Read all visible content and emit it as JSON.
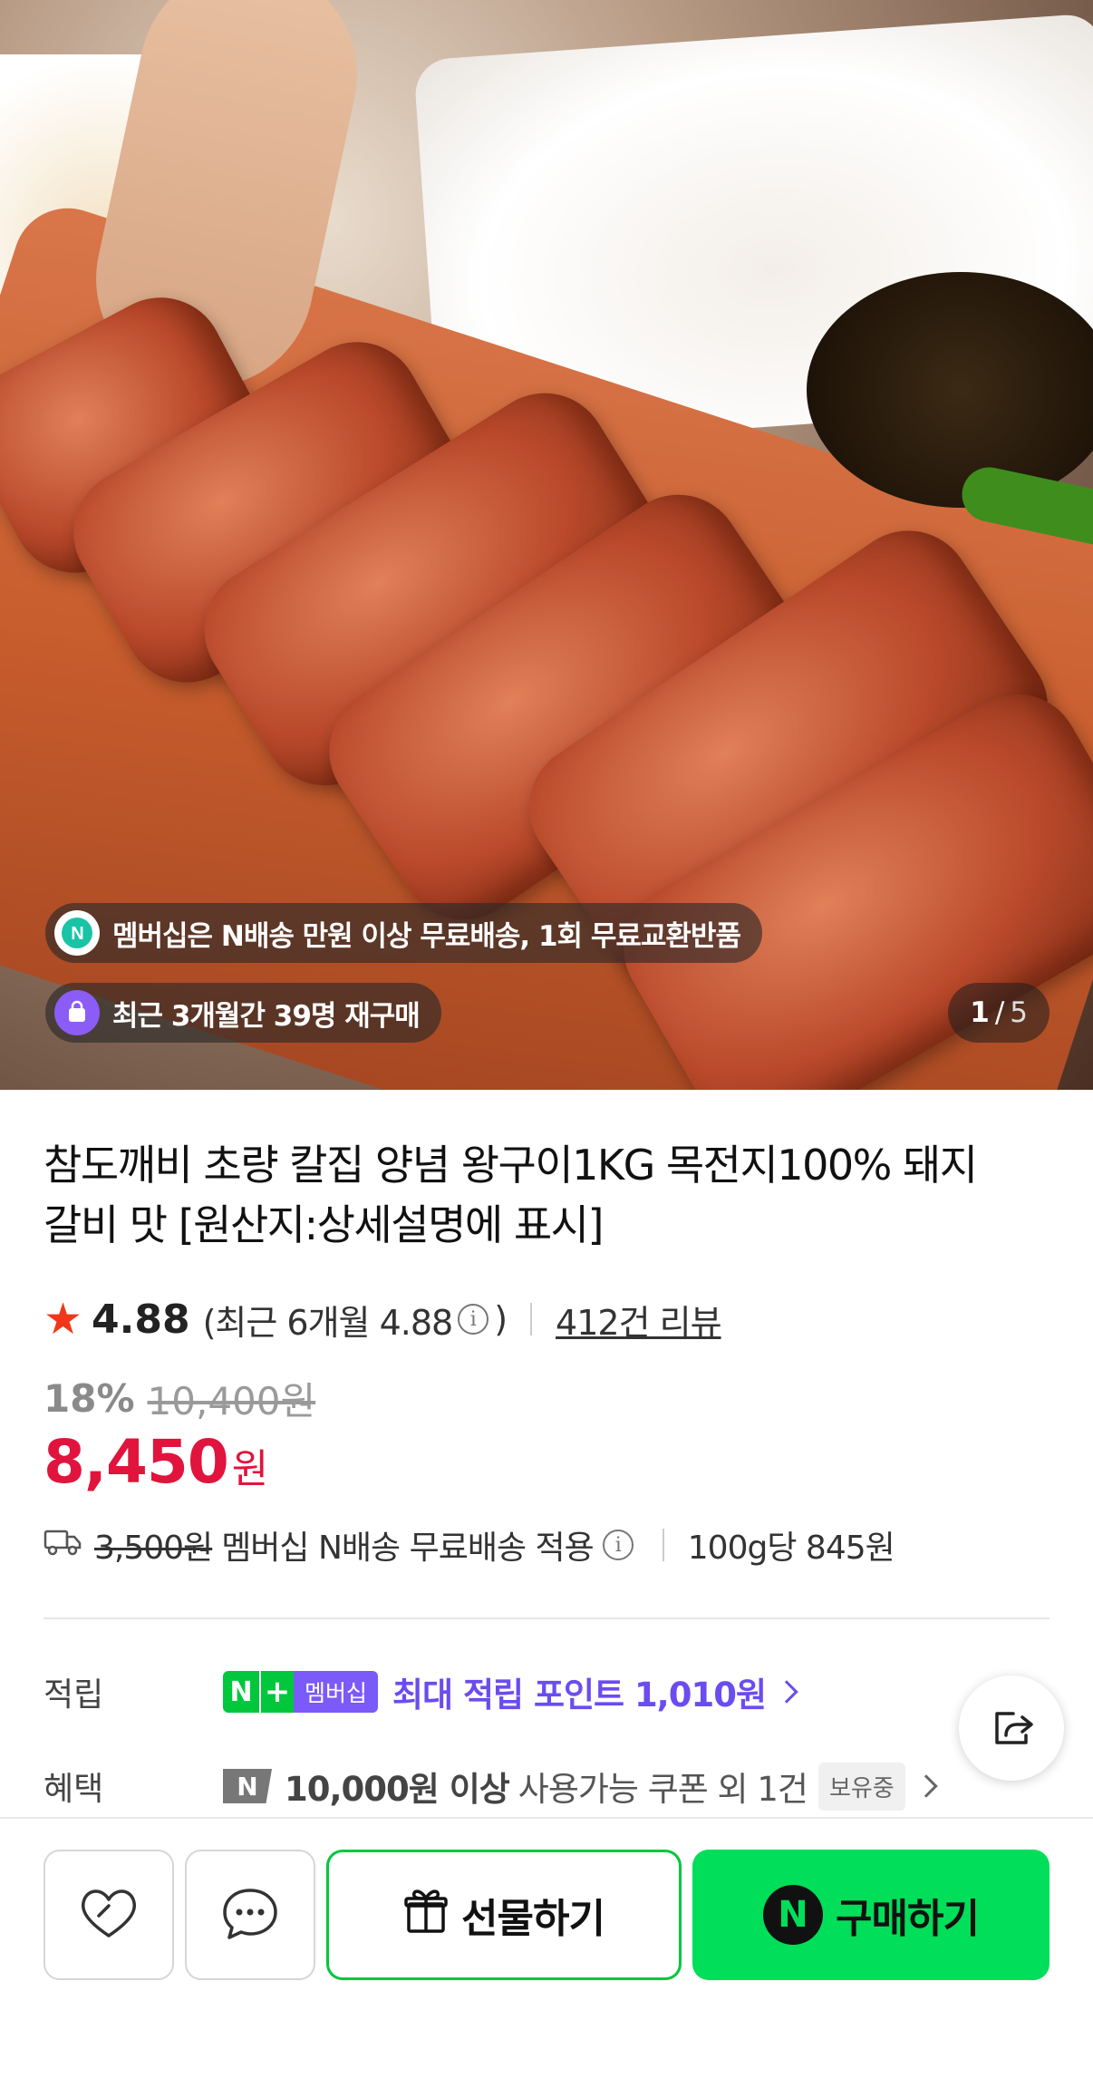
{
  "hero": {
    "membership_badge": "멤버십은 N배송 만원 이상 무료배송, 1회 무료교환반품",
    "repurchase_badge": "최근 3개월간 39명 재구매",
    "counter_current": "1",
    "counter_sep": "/",
    "counter_total": "5"
  },
  "product": {
    "title": "참도깨비 초량 칼집 양념 왕구이1KG 목전지100% 돼지갈비 맛 [원산지:상세설명에 표시]",
    "rating": "4.88",
    "recent_rating_prefix": "(최근 6개월 4.88",
    "recent_rating_suffix": ")",
    "review_count": "412건 리뷰",
    "discount_rate": "18%",
    "original_price": "10,400원",
    "sale_price": "8,450",
    "currency": "원"
  },
  "shipping": {
    "original_fee": "3,500원",
    "policy": "멤버십 N배송 무료배송 적용",
    "unit_price": "100g당 845원"
  },
  "benefits": {
    "points_label": "적립",
    "badge_n": "N",
    "badge_plus": "+",
    "badge_membership": "멤버십",
    "points_text": "최대 적립 포인트 1,010원",
    "coupon_label": "혜택",
    "coupon_icon": "N",
    "coupon_bold": "10,000원 이상",
    "coupon_text": "사용가능 쿠폰 외 1건",
    "coupon_owned": "보유중"
  },
  "actions": {
    "gift_label": "선물하기",
    "buy_icon": "N",
    "buy_label": "구매하기"
  },
  "colors": {
    "price_red": "#e0143c",
    "naver_green": "#00de5a",
    "membership_purple": "#6b4cf0",
    "star": "#f0371a"
  },
  "icons": [
    "truck-icon",
    "info-icon",
    "share-icon",
    "heart-icon",
    "chat-icon",
    "gift-icon",
    "star-icon",
    "shopping-bag-icon",
    "n-delivery-icon"
  ]
}
